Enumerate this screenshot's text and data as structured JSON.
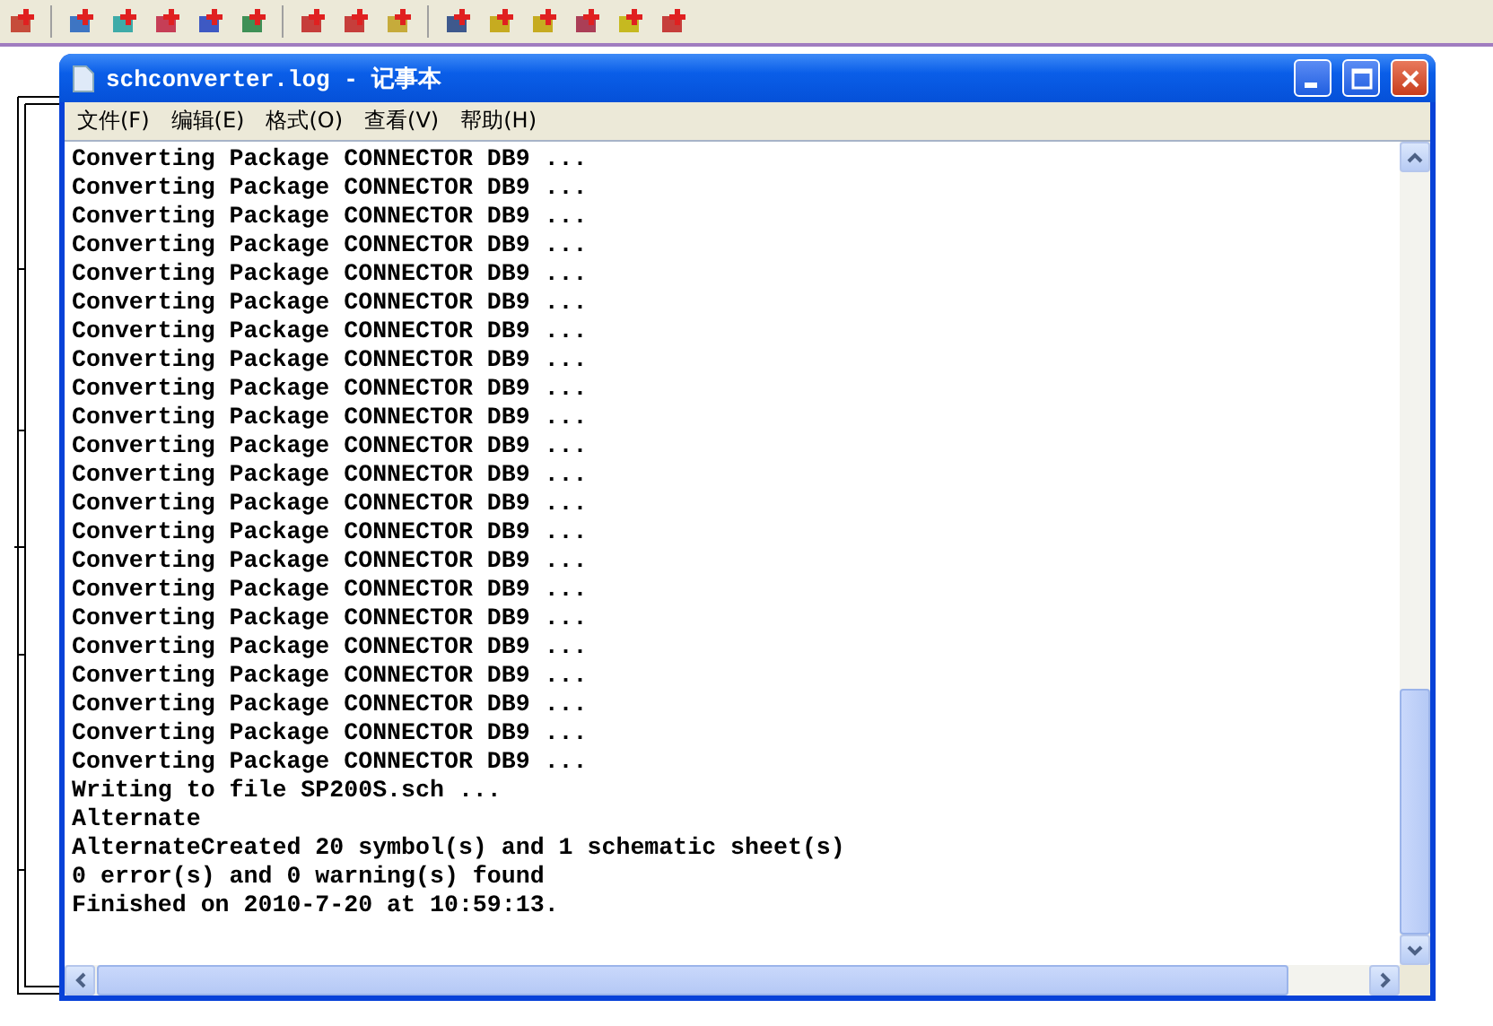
{
  "window": {
    "title": "schconverter.log - 记事本"
  },
  "menu": [
    "文件(F)",
    "编辑(E)",
    "格式(O)",
    "查看(V)",
    "帮助(H)"
  ],
  "lines": [
    "Converting Package CONNECTOR DB9 ...",
    "Converting Package CONNECTOR DB9 ...",
    "Converting Package CONNECTOR DB9 ...",
    "Converting Package CONNECTOR DB9 ...",
    "Converting Package CONNECTOR DB9 ...",
    "Converting Package CONNECTOR DB9 ...",
    "Converting Package CONNECTOR DB9 ...",
    "Converting Package CONNECTOR DB9 ...",
    "Converting Package CONNECTOR DB9 ...",
    "Converting Package CONNECTOR DB9 ...",
    "Converting Package CONNECTOR DB9 ...",
    "Converting Package CONNECTOR DB9 ...",
    "Converting Package CONNECTOR DB9 ...",
    "Converting Package CONNECTOR DB9 ...",
    "Converting Package CONNECTOR DB9 ...",
    "Converting Package CONNECTOR DB9 ...",
    "Converting Package CONNECTOR DB9 ...",
    "Converting Package CONNECTOR DB9 ...",
    "Converting Package CONNECTOR DB9 ...",
    "Converting Package CONNECTOR DB9 ...",
    "Converting Package CONNECTOR DB9 ...",
    "Converting Package CONNECTOR DB9 ...",
    "Writing to file SP200S.sch ...",
    "Alternate",
    "AlternateCreated 20 symbol(s) and 1 schematic sheet(s)",
    "0 error(s) and 0 warning(s) found",
    "Finished on 2010-7-20 at 10:59:13."
  ]
}
